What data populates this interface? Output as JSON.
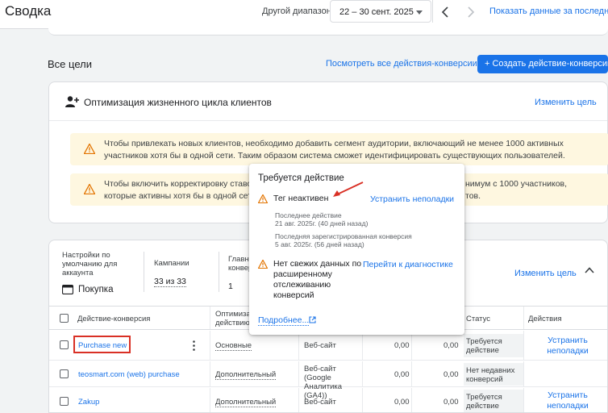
{
  "header": {
    "title": "Сводка",
    "range_label": "Другой диапазон",
    "date_range": "22 – 30 сент. 2025",
    "show_data_link": "Показать данные за последние 30"
  },
  "goals": {
    "section_title": "Все цели",
    "view_all_link": "Посмотреть все действия-конверсии",
    "create_button": "+ Создать действие-конверсию"
  },
  "lifecycle": {
    "title": "Оптимизация жизненного цикла клиентов",
    "edit_link": "Изменить цель",
    "warnings": [
      {
        "text": "Чтобы привлекать новых клиентов, необходимо добавить сегмент аудитории, включающий не менее 1000 активных участников хотя бы в одной сети. Таким образом система сможет идентифицировать существующих пользователей."
      },
      {
        "text_left": "Чтобы включить корректировку ставок",
        "text_right": "нимум с 1000 участников,",
        "text_line2_left": "которые активны хотя бы в одной сети.",
        "text_line2_right": "тов."
      }
    ]
  },
  "purchase_goal": {
    "settings_label": "Настройки по умолчанию для аккаунта",
    "goal_name": "Покупка",
    "campaigns_label": "Кампании",
    "campaigns_value": "33 из 33",
    "main_label": "Главна конвер",
    "main_value": "1",
    "edit_link": "Изменить цель"
  },
  "table": {
    "headers": {
      "action": "Действие-конверсия",
      "optimization": "Оптимизация действию",
      "status": "Статус",
      "actions": "Действия"
    },
    "rows": [
      {
        "name": "Purchase new",
        "optimization": "Основные",
        "source": "Веб-сайт",
        "v1": "0,00",
        "v2": "0,00",
        "status": "Требуется действие",
        "action": "Устранить неполадки"
      },
      {
        "name": "teosmart.com (web) purchase",
        "optimization": "Дополнительный",
        "source": "Веб-сайт (Google Аналитика (GA4))",
        "v1": "0,00",
        "v2": "0,00",
        "status": "Нет недавних конверсий",
        "action": ""
      },
      {
        "name": "Zakup",
        "optimization": "Дополнительный",
        "source": "Веб-сайт",
        "v1": "0,00",
        "v2": "0,00",
        "status": "Требуется действие",
        "action": "Устранить неполадки"
      }
    ]
  },
  "popup": {
    "title": "Требуется действие",
    "issue1": "Тег неактивен",
    "issue1_link": "Устранить неполадки",
    "detail1_label": "Последнее действие",
    "detail1_value": "21 авг. 2025г. (40 дней назад)",
    "detail2_label": "Последняя зарегистрированная конверсия",
    "detail2_value": "5 авг. 2025г. (56 дней назад)",
    "issue2": "Нет свежих данных по расширенному отслеживанию конверсий",
    "issue2_link": "Перейти к диагностике",
    "more_link": "Подробнее..."
  },
  "colors": {
    "accent": "#1a73e8",
    "warning": "#f29900",
    "warning_bg": "#fef7e0",
    "highlight": "#d93025"
  }
}
